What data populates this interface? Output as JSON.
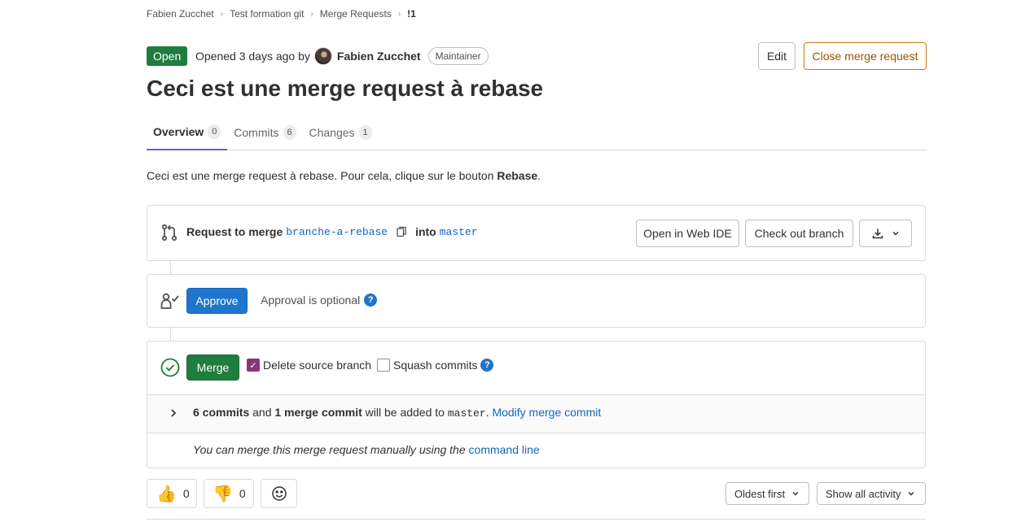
{
  "breadcrumb": [
    {
      "label": "Fabien Zucchet"
    },
    {
      "label": "Test formation git"
    },
    {
      "label": "Merge Requests"
    },
    {
      "label": "!1"
    }
  ],
  "header": {
    "status": "Open",
    "opened_prefix": "Opened 3 days ago by",
    "author": "Fabien Zucchet",
    "role": "Maintainer",
    "edit_label": "Edit",
    "close_label": "Close merge request",
    "title": "Ceci est une merge request à rebase"
  },
  "tabs": [
    {
      "label": "Overview",
      "count": "0"
    },
    {
      "label": "Commits",
      "count": "6"
    },
    {
      "label": "Changes",
      "count": "1"
    }
  ],
  "description": {
    "text": "Ceci est une merge request à rebase. Pour cela, clique sur le bouton ",
    "bold": "Rebase",
    "end": "."
  },
  "merge_info": {
    "request_label": "Request to merge",
    "source_branch": "branche-a-rebase",
    "into_label": "into",
    "target_branch": "master",
    "webide_label": "Open in Web IDE",
    "checkout_label": "Check out branch"
  },
  "approval": {
    "approve_label": "Approve",
    "text": "Approval is optional"
  },
  "merge": {
    "merge_label": "Merge",
    "delete_source_label": "Delete source branch",
    "delete_source_checked": true,
    "squash_label": "Squash commits",
    "squash_checked": false,
    "commits_count": "6 commits",
    "and": "and",
    "merge_commit_count": "1 merge commit",
    "added_to": "will be added to",
    "target": "master",
    "dot": ".",
    "modify_link": "Modify merge commit",
    "manual_text": "You can merge this merge request manually using the",
    "command_line_link": "command line"
  },
  "awards": {
    "thumbs_up": "0",
    "thumbs_down": "0"
  },
  "sort": {
    "order_label": "Oldest first",
    "filter_label": "Show all activity"
  },
  "colors": {
    "open_green": "#1f7d3e",
    "approve_blue": "#1f75cb",
    "link_blue": "#1068bf",
    "close_orange": "#9e5400",
    "tab_underline": "#6666c4",
    "checkbox_purple": "#8a3578"
  }
}
